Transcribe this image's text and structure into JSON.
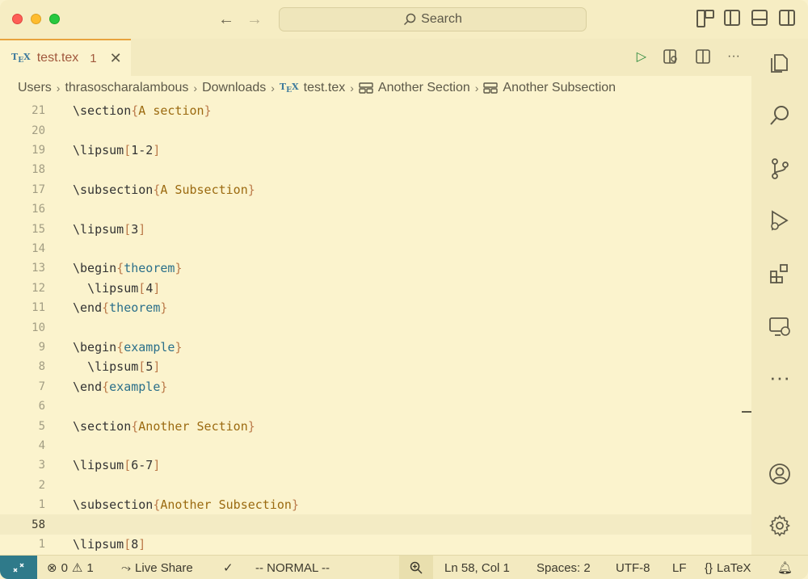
{
  "titlebar": {
    "search_label": "Search"
  },
  "tab": {
    "filename": "test.tex",
    "problem_count": "1"
  },
  "breadcrumb": [
    "Users",
    "thrasoscharalambous",
    "Downloads",
    "test.tex",
    "Another Section",
    "Another Subsection"
  ],
  "editor": {
    "lines": [
      {
        "num": "21",
        "cmd": "\\section",
        "open": "{",
        "arg": "A section",
        "close": "}",
        "argtype": "arg"
      },
      {
        "num": "20"
      },
      {
        "num": "19",
        "cmd": "\\lipsum",
        "open": "[",
        "arg": "1-2",
        "close": "]",
        "argtype": "num"
      },
      {
        "num": "18"
      },
      {
        "num": "17",
        "cmd": "\\subsection",
        "open": "{",
        "arg": "A Subsection",
        "close": "}",
        "argtype": "arg"
      },
      {
        "num": "16"
      },
      {
        "num": "15",
        "cmd": "\\lipsum",
        "open": "[",
        "arg": "3",
        "close": "]",
        "argtype": "num"
      },
      {
        "num": "14"
      },
      {
        "num": "13",
        "cmd": "\\begin",
        "open": "{",
        "arg": "theorem",
        "close": "}",
        "argtype": "env"
      },
      {
        "num": "12",
        "indent": "  ",
        "cmd": "\\lipsum",
        "open": "[",
        "arg": "4",
        "close": "]",
        "argtype": "num"
      },
      {
        "num": "11",
        "cmd": "\\end",
        "open": "{",
        "arg": "theorem",
        "close": "}",
        "argtype": "env"
      },
      {
        "num": "10"
      },
      {
        "num": "9",
        "cmd": "\\begin",
        "open": "{",
        "arg": "example",
        "close": "}",
        "argtype": "env"
      },
      {
        "num": "8",
        "indent": "  ",
        "cmd": "\\lipsum",
        "open": "[",
        "arg": "5",
        "close": "]",
        "argtype": "num"
      },
      {
        "num": "7",
        "cmd": "\\end",
        "open": "{",
        "arg": "example",
        "close": "}",
        "argtype": "env"
      },
      {
        "num": "6"
      },
      {
        "num": "5",
        "cmd": "\\section",
        "open": "{",
        "arg": "Another Section",
        "close": "}",
        "argtype": "arg"
      },
      {
        "num": "4"
      },
      {
        "num": "3",
        "cmd": "\\lipsum",
        "open": "[",
        "arg": "6-7",
        "close": "]",
        "argtype": "num"
      },
      {
        "num": "2"
      },
      {
        "num": "1",
        "cmd": "\\subsection",
        "open": "{",
        "arg": "Another Subsection",
        "close": "}",
        "argtype": "arg"
      },
      {
        "num": "58",
        "current": true
      },
      {
        "num": "1",
        "cmd": "\\lipsum",
        "open": "[",
        "arg": "8",
        "close": "]",
        "argtype": "num"
      }
    ]
  },
  "statusbar": {
    "errors": "0",
    "warnings": "1",
    "live_share": "Live Share",
    "vim_mode": "-- NORMAL --",
    "position": "Ln 58, Col 1",
    "spaces": "Spaces: 2",
    "encoding": "UTF-8",
    "eol": "LF",
    "language": "LaTeX"
  },
  "colors": {
    "accent": "#e8a33d",
    "remote": "#2f7a8a",
    "background": "#fbf3cd"
  }
}
